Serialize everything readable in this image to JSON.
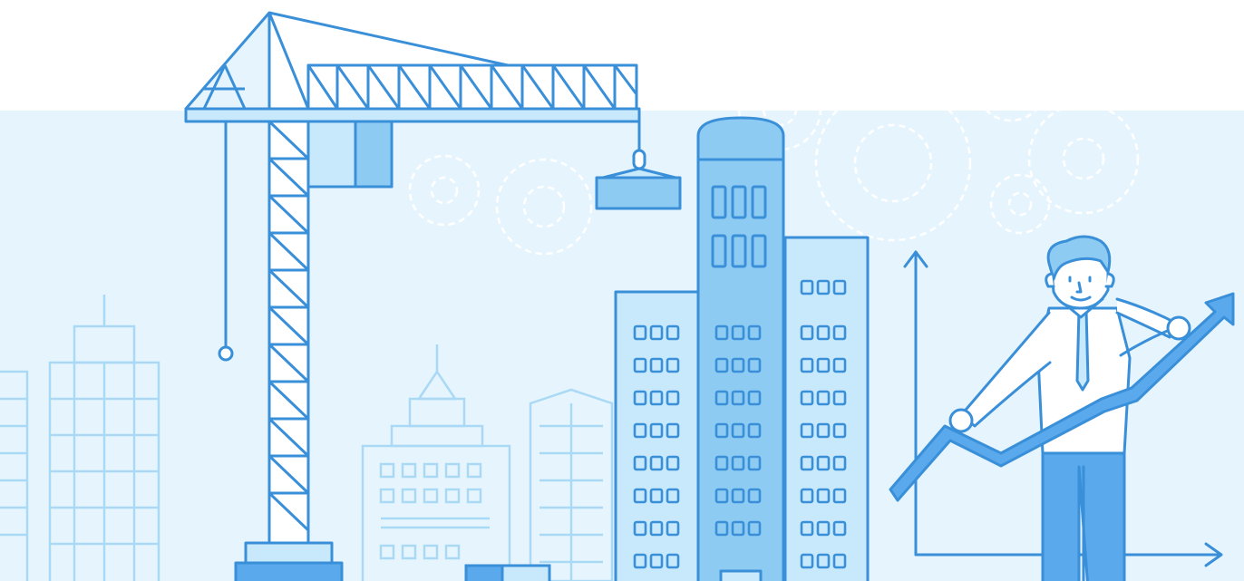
{
  "image": {
    "subject": "construction-and-growth-illustration",
    "palette": {
      "background_top": "#ffffff",
      "background_band": "#e6f5fd",
      "outline": "#3a8fd9",
      "fill_light": "#c8e9fb",
      "fill_mid": "#8ecbf3",
      "fill_accent": "#5aa9ec",
      "skyline_faint": "#a9d9f5",
      "gears": "#ffffff"
    },
    "elements": [
      "tower-crane",
      "crane-load",
      "crane-hook",
      "tall-office-building",
      "background-skyline",
      "gear-cloud",
      "chart-axes",
      "growth-arrow",
      "businessman"
    ]
  }
}
